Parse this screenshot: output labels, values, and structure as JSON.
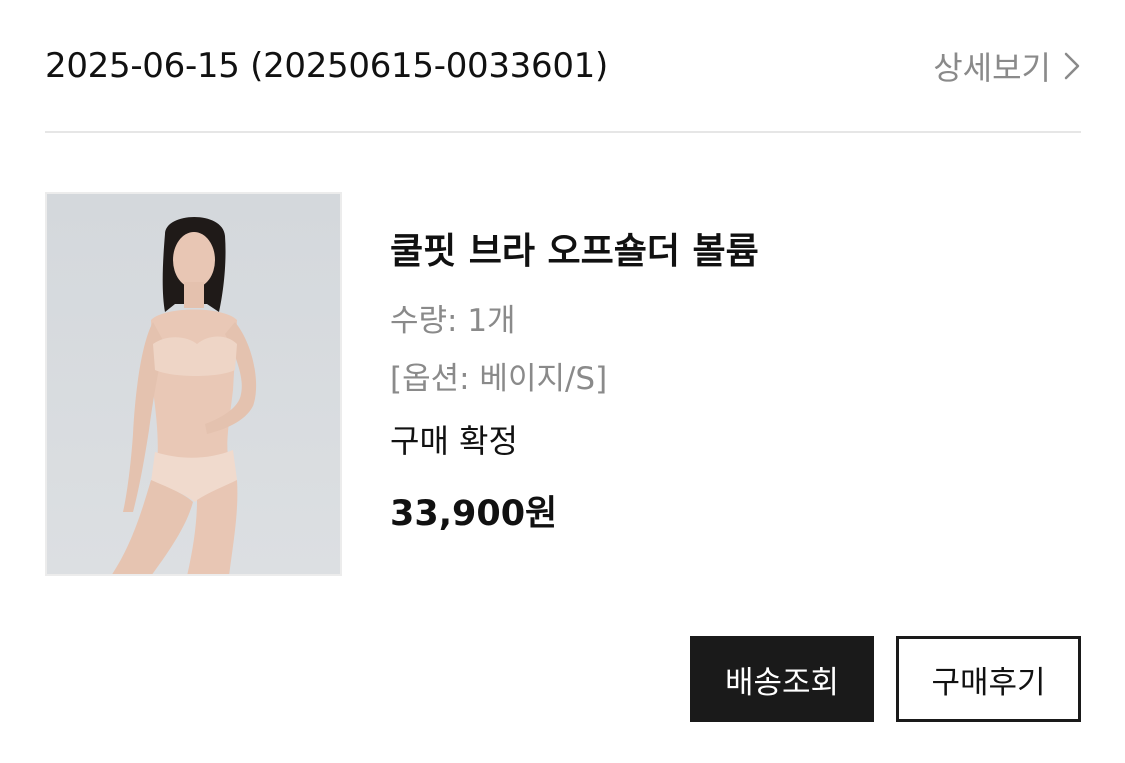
{
  "order": {
    "date_id": "2025-06-15 (20250615-0033601)",
    "detail_link": "상세보기",
    "detail_icon": "chevron-right-icon"
  },
  "product": {
    "image": "product-photo",
    "name": "쿨핏 브라 오프숄더 볼륨",
    "quantity": "수량: 1개",
    "option": "[옵션: 베이지/S]",
    "status": "구매 확정",
    "price": "33,900원"
  },
  "actions": {
    "track_delivery": "배송조회",
    "write_review": "구매후기"
  },
  "colors": {
    "primary_button_bg": "#1a1a1a",
    "muted_text": "#8a8a8a",
    "divider": "#e6e6e6"
  }
}
